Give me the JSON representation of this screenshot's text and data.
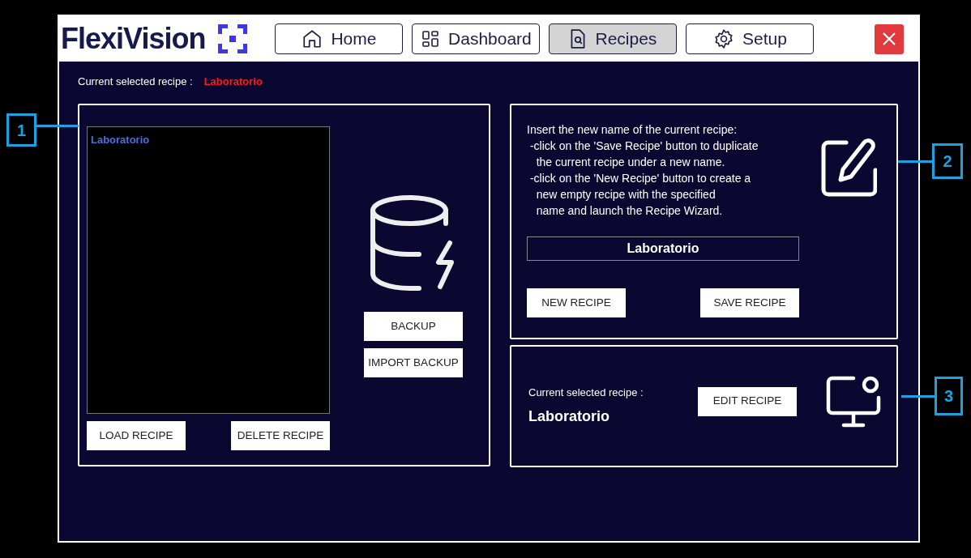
{
  "logo": {
    "text": "FlexiVision"
  },
  "nav": [
    {
      "label": "Home",
      "selected": false
    },
    {
      "label": "Dashboard",
      "selected": false
    },
    {
      "label": "Recipes",
      "selected": true
    },
    {
      "label": "Setup",
      "selected": false
    }
  ],
  "current": {
    "label": "Current selected recipe :",
    "value": "Laboratorio"
  },
  "library": {
    "recipes": [
      {
        "name": "Laboratorio",
        "selected": false
      }
    ],
    "buttons": [
      "LOAD RECIPE",
      "DELETE RECIPE"
    ],
    "backup_buttons": [
      "BACKUP",
      "IMPORT BACKUP"
    ]
  },
  "rename": {
    "instructions": [
      "Insert the new name of the current recipe:",
      " -click on the 'Save Recipe' button to duplicate",
      "   the current recipe under a new name.",
      " -click on the 'New Recipe' button to create a",
      "   new empty recipe with the specified",
      "   name and launch the Recipe Wizard."
    ],
    "name_value": "Laboratorio",
    "buttons": [
      "NEW RECIPE",
      "SAVE RECIPE"
    ]
  },
  "edit": {
    "label": "Current selected recipe :",
    "value": "Laboratorio",
    "button": "EDIT RECIPE"
  },
  "callouts": [
    "1",
    "2",
    "3"
  ]
}
